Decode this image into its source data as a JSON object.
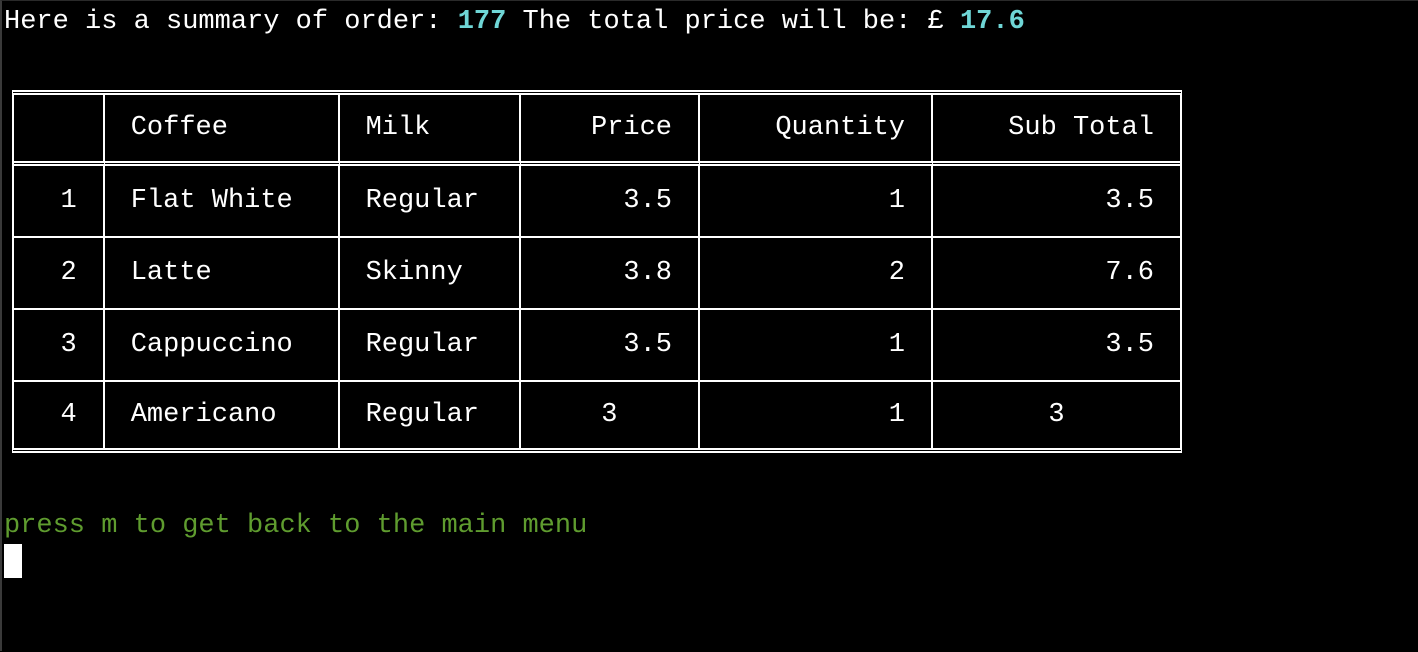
{
  "colors": {
    "accent": "#6fd6d6",
    "prompt": "#5f9c2f",
    "text": "#ffffff",
    "background": "#000000"
  },
  "summary": {
    "prefix": "Here is a summary of order: ",
    "order_number": "177",
    "middle": " The total price will be: £ ",
    "total": "17.6"
  },
  "table": {
    "headers": [
      "",
      "Coffee",
      "Milk",
      "Price",
      "Quantity",
      "Sub Total"
    ],
    "rows": [
      {
        "index": "1",
        "coffee": "Flat White",
        "milk": "Regular",
        "price": "3.5",
        "quantity": "1",
        "subtotal": "3.5"
      },
      {
        "index": "2",
        "coffee": "Latte",
        "milk": "Skinny",
        "price": "3.8",
        "quantity": "2",
        "subtotal": "7.6"
      },
      {
        "index": "3",
        "coffee": "Cappuccino",
        "milk": "Regular",
        "price": "3.5",
        "quantity": "1",
        "subtotal": "3.5"
      },
      {
        "index": "4",
        "coffee": "Americano",
        "milk": "Regular",
        "price": "3",
        "quantity": "1",
        "subtotal": "3"
      }
    ]
  },
  "prompt": {
    "text": "press m to get back to the main menu"
  }
}
